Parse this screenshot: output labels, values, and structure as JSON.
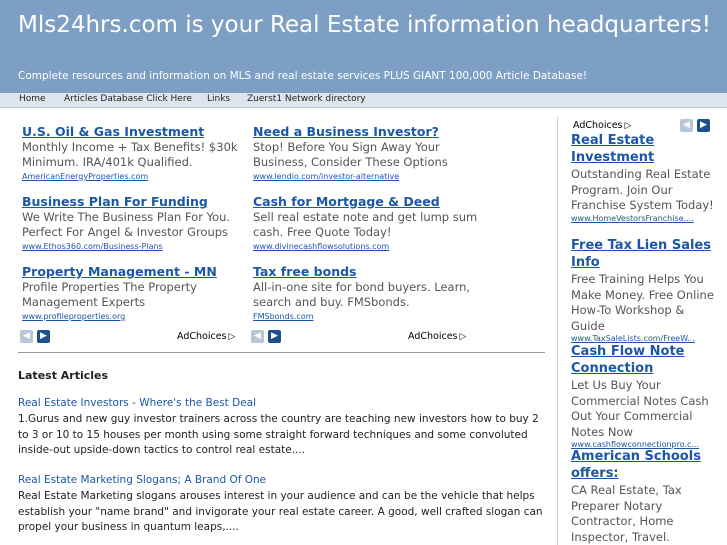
{
  "header": {
    "title": "Mls24hrs.com is your Real Estate information headquarters!",
    "tagline": "Complete resources and information on MLS and real estate services PLUS GIANT 100,000 Article Database!"
  },
  "nav": [
    "Home",
    "Articles Database Click Here",
    "Links",
    "Zuerst1 Network directory"
  ],
  "ads_left": [
    {
      "title": "U.S. Oil & Gas Investment",
      "desc": "Monthly Income + Tax Benefits! $30k Minimum. IRA/401k Qualified.",
      "url": "AmericanEnergyProperties.com"
    },
    {
      "title": "Business Plan For Funding",
      "desc": "We Write The Business Plan For You. Perfect For Angel & Investor Groups",
      "url": "www.Ethos360.com/Business-Plans"
    },
    {
      "title": "Property Management - MN",
      "desc": "Profile Properties The Property Management Experts",
      "url": "www.profileproperties.org"
    }
  ],
  "ads_right": [
    {
      "title": "Need a Business Investor?",
      "desc": "Stop! Before You Sign Away Your Business, Consider These Options",
      "url": "www.lendio.com/investor-alternative"
    },
    {
      "title": "Cash for Mortgage & Deed",
      "desc": "Sell real estate note and get lump sum cash. Free Quote Today!",
      "url": "www.divinecashflowsolutions.com"
    },
    {
      "title": "Tax free bonds",
      "desc": "All-in-one site for bond buyers. Learn, search and buy. FMSbonds.",
      "url": "FMSbonds.com"
    }
  ],
  "adchoices_label": "AdChoices",
  "latest": {
    "heading": "Latest Articles",
    "articles": [
      {
        "title": "Real Estate Investors - Where's the Best Deal",
        "body": "1.Gurus and new guy investor trainers across the country are teaching new investors how to buy 2 to 3 or 10 to 15 houses per month using some straight forward techniques and some convoluted inside-out upside-down tactics to control real estate...."
      },
      {
        "title": "Real Estate Marketing Slogans; A Brand Of One",
        "body": "Real Estate Marketing slogans arouses interest in your audience and can be the vehicle that helps establish your \"name brand\" and invigorate your real estate career. A good, well crafted slogan can propel your business in quantum leaps,...."
      }
    ]
  },
  "sidebar_ads": [
    {
      "title": "Real Estate Investment",
      "desc": "Outstanding Real Estate Program. Join Our Franchise System Today!",
      "url": "www.HomeVestorsFranchise...."
    },
    {
      "title": "Free Tax Lien Sales Info",
      "desc": "Free Training Helps You Make Money. Free Online How-To Workshop & Guide",
      "url": "www.TaxSaleLists.com/FreeW..."
    },
    {
      "title": "Cash Flow Note Connection",
      "desc": "Let Us Buy Your Commercial Notes Cash Out Your Commercial Notes Now",
      "url": "www.cashflowconnectionpro.c..."
    },
    {
      "title": "American Schools offers:",
      "desc": "CA Real Estate, Tax Preparer Notary Contractor, Home Inspector, Travel.",
      "url": ""
    }
  ]
}
